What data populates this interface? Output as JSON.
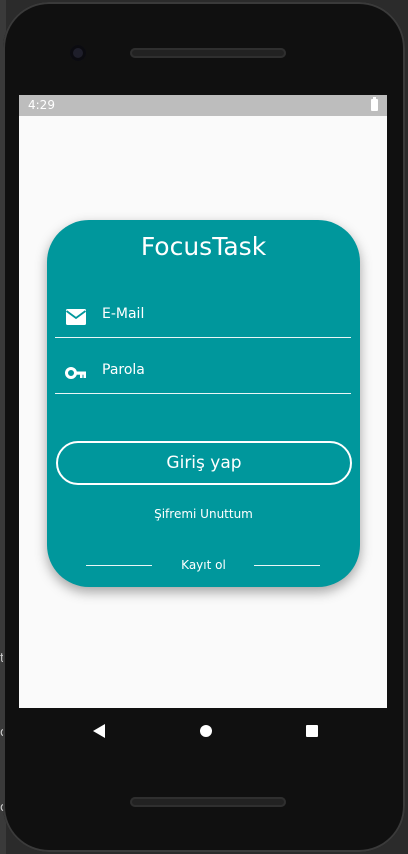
{
  "ide": {
    "frag_a": "t",
    "frag_b": "o",
    "frag_c": "o"
  },
  "status_bar": {
    "time": "4:29",
    "battery_icon": "battery-icon"
  },
  "app": {
    "title": "FocusTask",
    "email": {
      "label": "E-Mail",
      "icon": "mail-icon"
    },
    "password": {
      "label": "Parola",
      "icon": "key-icon"
    },
    "login_button": "Giriş yap",
    "forgot_password": "Şifremi Unuttum",
    "register": "Kayıt ol"
  },
  "navigation": {
    "back": "back-icon",
    "home": "home-icon",
    "recents": "recents-icon"
  },
  "colors": {
    "card": "#00979c",
    "screen_bg": "#fafafa",
    "status_bar": "#bdbdbd",
    "text": "#ffffff"
  }
}
